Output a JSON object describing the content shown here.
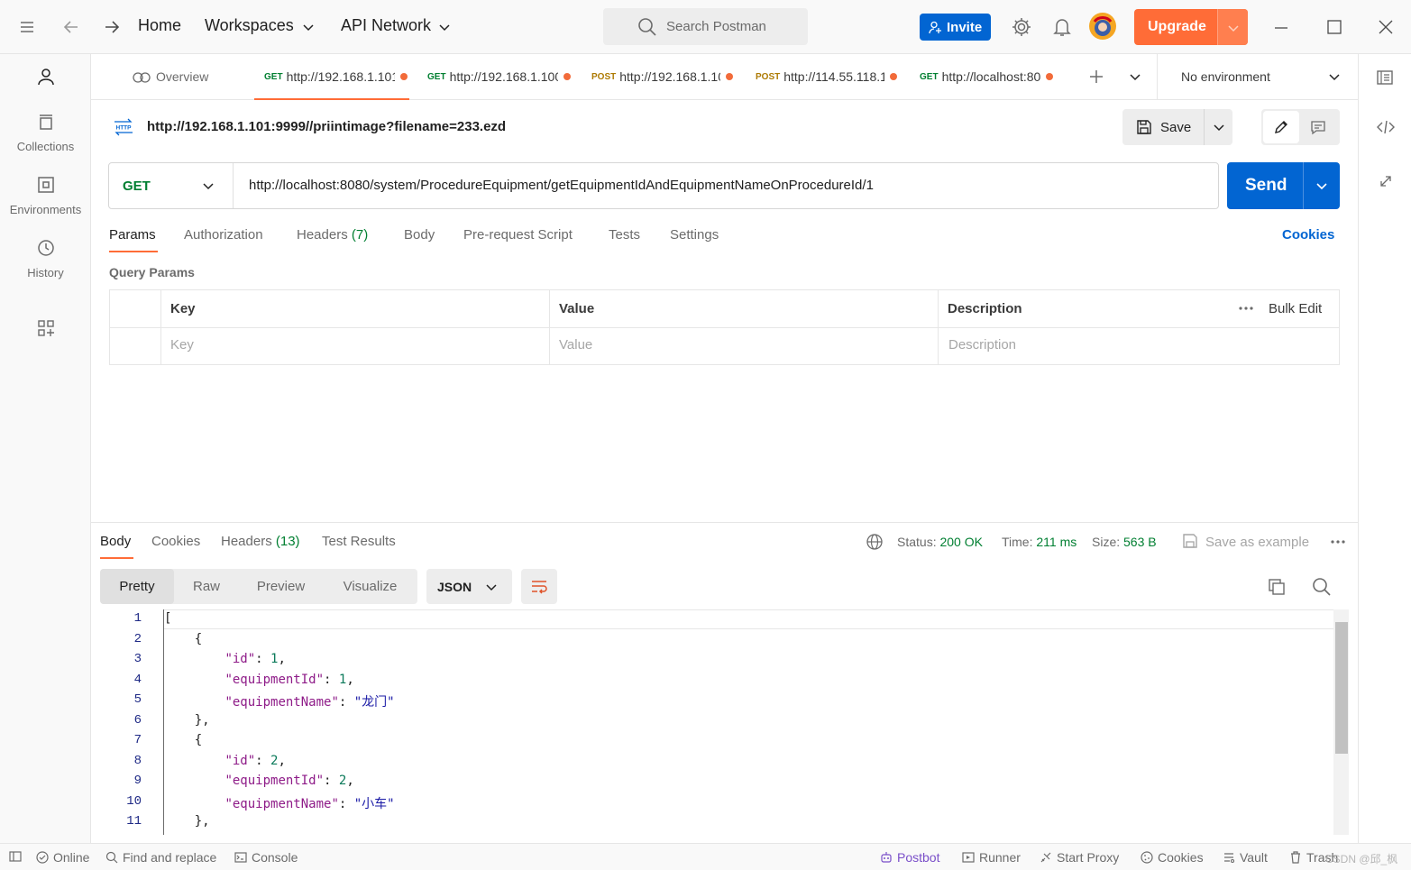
{
  "topbar": {
    "home": "Home",
    "workspaces": "Workspaces",
    "api_network": "API Network",
    "search_placeholder": "Search Postman",
    "invite": "Invite",
    "upgrade": "Upgrade"
  },
  "sidebar": {
    "items": [
      {
        "label": "Collections",
        "icon": "collections-icon"
      },
      {
        "label": "Environments",
        "icon": "environments-icon"
      },
      {
        "label": "History",
        "icon": "history-icon"
      }
    ]
  },
  "tabs": {
    "overview": "Overview",
    "items": [
      {
        "method": "GET",
        "url": "http://192.168.1.101"
      },
      {
        "method": "GET",
        "url": "http://192.168.1.100"
      },
      {
        "method": "POST",
        "url": "http://192.168.1.10"
      },
      {
        "method": "POST",
        "url": "http://114.55.118.1"
      },
      {
        "method": "GET",
        "url": "http://localhost:80"
      }
    ],
    "environment": "No environment"
  },
  "request": {
    "title": "http://192.168.1.101:9999//priintimage?filename=233.ezd",
    "save": "Save",
    "method": "GET",
    "url": "http://localhost:8080/system/ProcedureEquipment/getEquipmentIdAndEquipmentNameOnProcedureId/1",
    "send": "Send",
    "tabs": {
      "params": "Params",
      "authorization": "Authorization",
      "headers": "Headers",
      "headers_count": "(7)",
      "body": "Body",
      "pre_request": "Pre-request Script",
      "tests": "Tests",
      "settings": "Settings"
    },
    "cookies": "Cookies",
    "query_params_title": "Query Params",
    "table": {
      "key_header": "Key",
      "value_header": "Value",
      "description_header": "Description",
      "bulk_edit": "Bulk Edit",
      "key_placeholder": "Key",
      "value_placeholder": "Value",
      "description_placeholder": "Description"
    }
  },
  "response": {
    "tabs": {
      "body": "Body",
      "cookies": "Cookies",
      "headers": "Headers",
      "headers_count": "(13)",
      "test_results": "Test Results"
    },
    "status_label": "Status:",
    "status_value": "200 OK",
    "time_label": "Time:",
    "time_value": "211 ms",
    "size_label": "Size:",
    "size_value": "563 B",
    "save_example": "Save as example",
    "view_modes": [
      "Pretty",
      "Raw",
      "Preview",
      "Visualize"
    ],
    "format": "JSON",
    "lines": [
      {
        "n": "1",
        "text": "["
      },
      {
        "n": "2",
        "text": "    {"
      },
      {
        "n": "3",
        "key": "\"id\"",
        "val": "1",
        "type": "num"
      },
      {
        "n": "4",
        "key": "\"equipmentId\"",
        "val": "1",
        "type": "num"
      },
      {
        "n": "5",
        "key": "\"equipmentName\"",
        "val": "\"龙门\"",
        "type": "str"
      },
      {
        "n": "6",
        "text": "    },"
      },
      {
        "n": "7",
        "text": "    {"
      },
      {
        "n": "8",
        "key": "\"id\"",
        "val": "2",
        "type": "num"
      },
      {
        "n": "9",
        "key": "\"equipmentId\"",
        "val": "2",
        "type": "num"
      },
      {
        "n": "10",
        "key": "\"equipmentName\"",
        "val": "\"小车\"",
        "type": "str"
      },
      {
        "n": "11",
        "text": "    },"
      }
    ]
  },
  "statusbar": {
    "online": "Online",
    "find_replace": "Find and replace",
    "console": "Console",
    "postbot": "Postbot",
    "runner": "Runner",
    "start_proxy": "Start Proxy",
    "cookies": "Cookies",
    "vault": "Vault",
    "trash": "Trash",
    "watermark": "CSDN @邱_枫"
  },
  "colors": {
    "accent": "#ff6c37",
    "primary": "#0265d2",
    "success": "#007f31"
  }
}
